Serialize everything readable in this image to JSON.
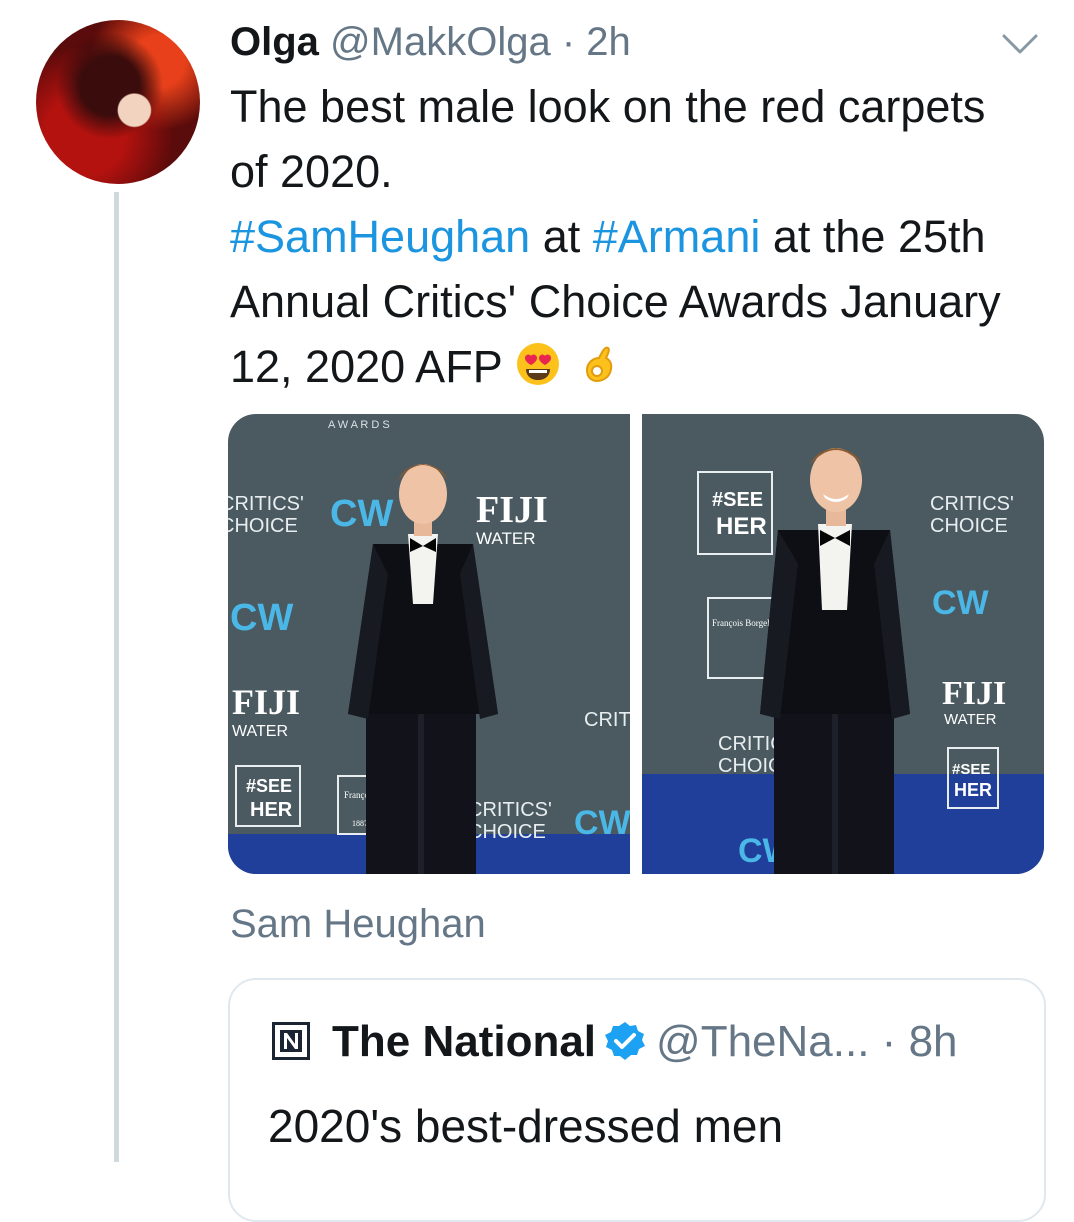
{
  "tweet": {
    "author_name": "Olga",
    "author_handle": "@MakkOlga",
    "separator": "·",
    "time": "2h",
    "text_line1": "The best male look on the red carpets of 2020.",
    "hashtag1": "#SamHeughan",
    "text_at": "at",
    "hashtag2": "#Armani",
    "text_rest": "at the 25th Annual Critics' Choice Awards January 12, 2020 AFP",
    "emojis": [
      "heart-eyes-emoji",
      "ok-hand-emoji"
    ],
    "media_caption": "Sam Heughan"
  },
  "backdrop_text": {
    "awards": "A W A R D S",
    "critics": "CRITICS'",
    "choice": "CHOICE",
    "fiji": "FIJI",
    "water": "WATER",
    "see": "#SEE",
    "her": "HER",
    "cw": "CW",
    "borgel": "François Borgel",
    "geneve": "1887 Genève"
  },
  "quote": {
    "account_name": "The National",
    "account_handle": "@TheNa...",
    "separator": "·",
    "time": "8h",
    "text": "2020's best-dressed men"
  },
  "colors": {
    "link": "#1b95e0",
    "muted": "#657786",
    "backdrop": "#4a5a60",
    "carpet": "#1f3f9a",
    "verified": "#1da1f2"
  },
  "icons": {
    "caret": "chevron-down-icon",
    "verified": "verified-badge-icon",
    "logo": "the-national-logo-icon"
  }
}
